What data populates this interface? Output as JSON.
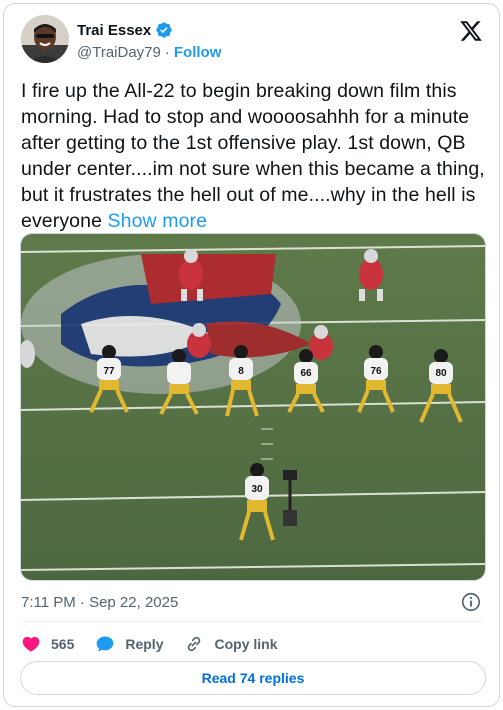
{
  "author": {
    "display_name": "Trai Essex",
    "handle": "@TraiDay79",
    "separator": "·",
    "follow_label": "Follow"
  },
  "tweet": {
    "text": "I fire up the All-22 to begin breaking down film this morning.  Had to stop and woooosahhh for a minute after getting to the 1st offensive play.  1st down, QB under center....im not sure when this became a thing, but it frustrates the hell out of me....why in the hell is everyone ",
    "show_more_label": "Show more",
    "timestamp": "7:11 PM · Sep 22, 2025"
  },
  "media": {
    "jersey_numbers": [
      "77",
      "8",
      "66",
      "76",
      "80",
      "30"
    ]
  },
  "actions": {
    "like_count": "565",
    "reply_label": "Reply",
    "copy_link_label": "Copy link"
  },
  "replies_button": {
    "label": "Read 74 replies"
  },
  "colors": {
    "accent": "#1d9bf0",
    "like": "#f91880",
    "muted": "#536471",
    "border": "#cfd9de"
  }
}
